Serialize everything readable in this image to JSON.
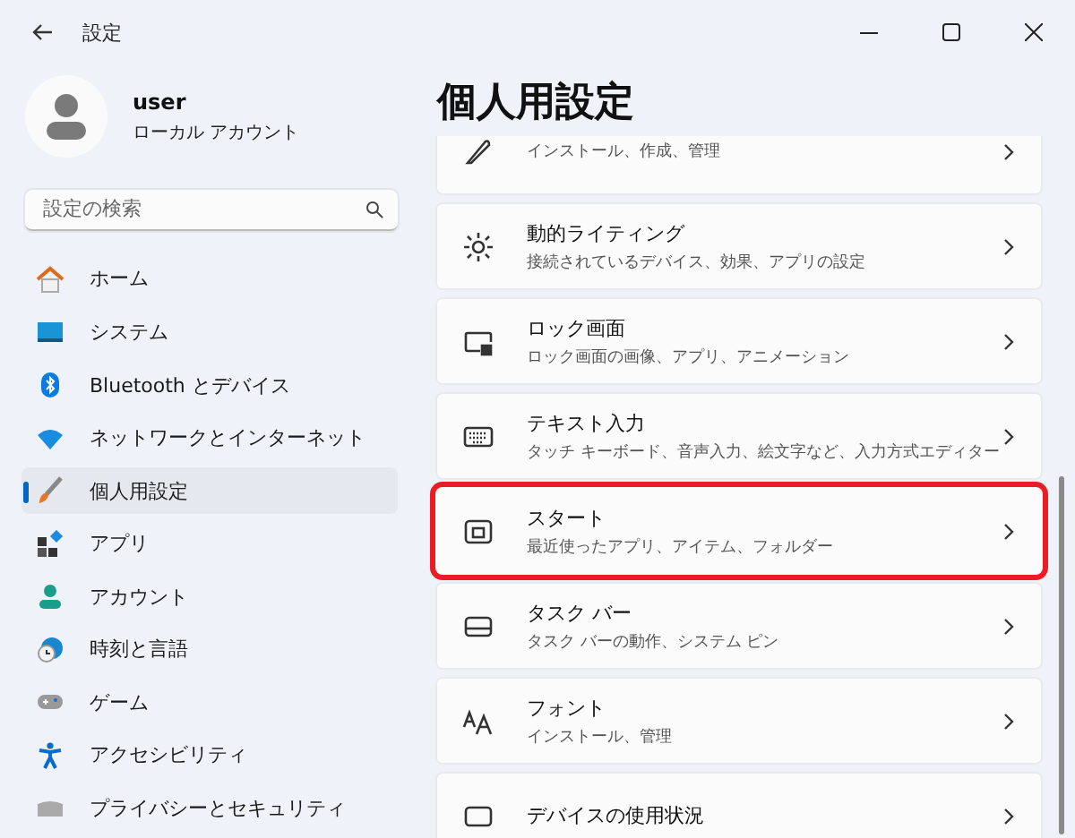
{
  "window": {
    "title": "設定"
  },
  "profile": {
    "name": "user",
    "account": "ローカル アカウント"
  },
  "search": {
    "placeholder": "設定の検索"
  },
  "nav": [
    {
      "label": "ホーム",
      "selected": false
    },
    {
      "label": "システム",
      "selected": false
    },
    {
      "label": "Bluetooth とデバイス",
      "selected": false
    },
    {
      "label": "ネットワークとインターネット",
      "selected": false
    },
    {
      "label": "個人用設定",
      "selected": true
    },
    {
      "label": "アプリ",
      "selected": false
    },
    {
      "label": "アカウント",
      "selected": false
    },
    {
      "label": "時刻と言語",
      "selected": false
    },
    {
      "label": "ゲーム",
      "selected": false
    },
    {
      "label": "アクセシビリティ",
      "selected": false
    },
    {
      "label": "プライバシーとセキュリティ",
      "selected": false
    }
  ],
  "page_title": "個人用設定",
  "cards": [
    {
      "subtitle": "インストール、作成、管理",
      "highlighted": false
    },
    {
      "title": "動的ライティング",
      "subtitle": "接続されているデバイス、効果、アプリの設定",
      "highlighted": false
    },
    {
      "title": "ロック画面",
      "subtitle": "ロック画面の画像、アプリ、アニメーション",
      "highlighted": false
    },
    {
      "title": "テキスト入力",
      "subtitle": "タッチ キーボード、音声入力、絵文字など、入力方式エディター",
      "highlighted": false
    },
    {
      "title": "スタート",
      "subtitle": "最近使ったアプリ、アイテム、フォルダー",
      "highlighted": true
    },
    {
      "title": "タスク バー",
      "subtitle": "タスク バーの動作、システム ピン",
      "highlighted": false
    },
    {
      "title": "フォント",
      "subtitle": "インストール、管理",
      "highlighted": false
    },
    {
      "title": "デバイスの使用状況",
      "highlighted": false
    }
  ]
}
